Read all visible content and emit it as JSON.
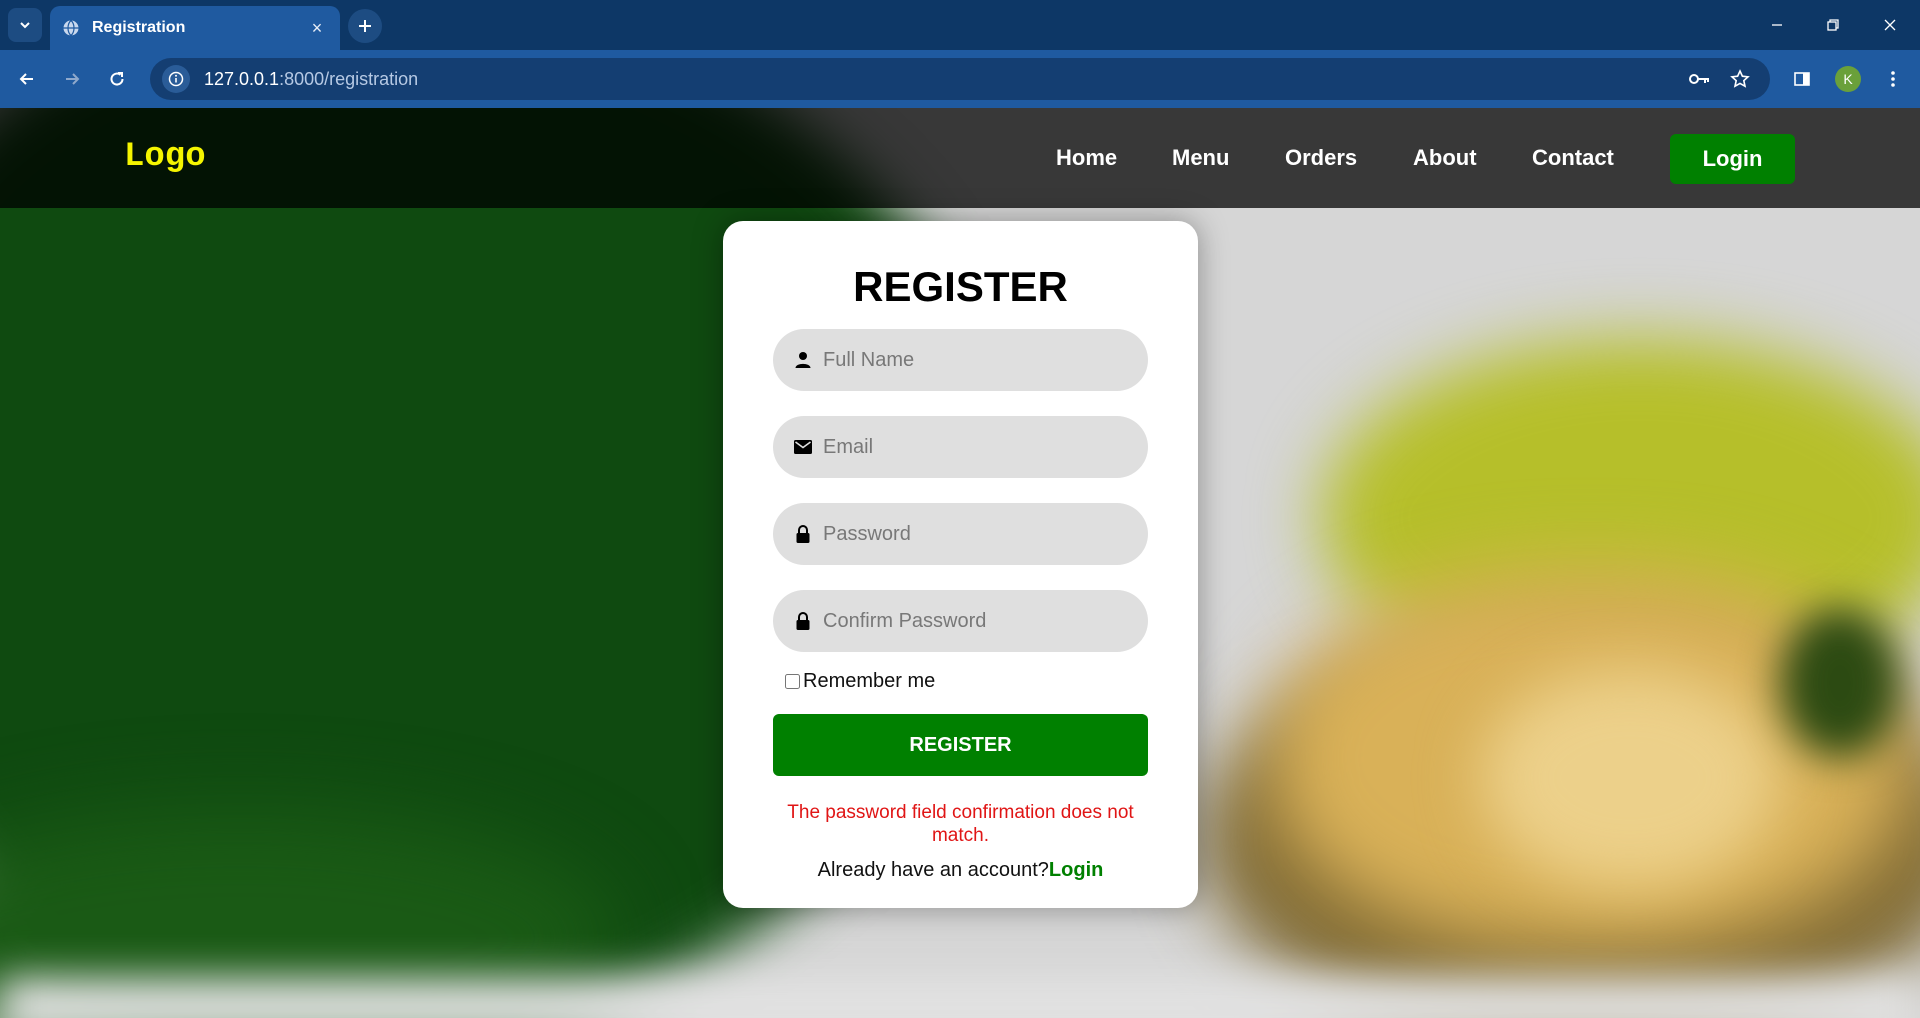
{
  "browser": {
    "tab_title": "Registration",
    "tab_close": "×",
    "url_host": "127.0.0.1",
    "url_path": ":8000/registration",
    "profile_initial": "K"
  },
  "nav": {
    "logo": "Logo",
    "links": [
      "Home",
      "Menu",
      "Orders",
      "About",
      "Contact"
    ],
    "login": "Login"
  },
  "form": {
    "title": "REGISTER",
    "fields": [
      {
        "placeholder": "Full Name",
        "icon": "user-icon"
      },
      {
        "placeholder": "Email",
        "icon": "envelope-icon"
      },
      {
        "placeholder": "Password",
        "icon": "lock-icon"
      },
      {
        "placeholder": "Confirm Password",
        "icon": "lock-icon"
      }
    ],
    "remember_label": "Remember me",
    "submit_label": "REGISTER",
    "error": "The password field confirmation does not match.",
    "already_text": "Already have an account?",
    "login_link": "Login"
  },
  "colors": {
    "accent_green": "#008000",
    "logo_yellow": "#f5f500",
    "error_red": "#e01515"
  }
}
